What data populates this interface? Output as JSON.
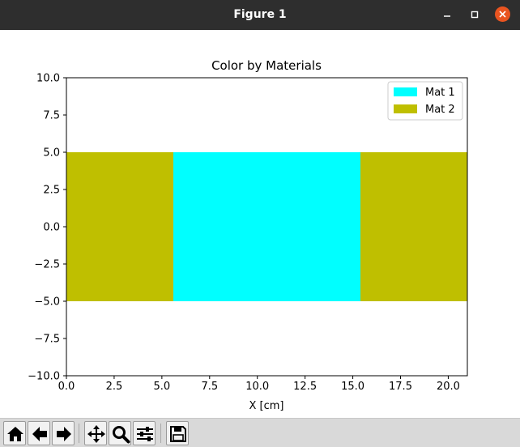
{
  "window": {
    "title": "Figure 1"
  },
  "chart_data": {
    "type": "bar",
    "title": "Color by Materials",
    "xlabel": "X [cm]",
    "ylabel": "",
    "xlim": [
      0,
      21
    ],
    "ylim": [
      -10,
      10
    ],
    "xticks": [
      "0.0",
      "2.5",
      "5.0",
      "7.5",
      "10.0",
      "12.5",
      "15.0",
      "17.5",
      "20.0"
    ],
    "yticks": [
      "10.0",
      "7.5",
      "5.0",
      "2.5",
      "0.0",
      "−2.5",
      "−5.0",
      "−7.5",
      "−10.0"
    ],
    "grid": false,
    "legend_position": "upper right",
    "series": [
      {
        "name": "Mat 1",
        "color": "#00ffff",
        "segments": [
          {
            "x0": 5.6,
            "x1": 15.4,
            "y0": -5,
            "y1": 5
          }
        ]
      },
      {
        "name": "Mat 2",
        "color": "#bfbf00",
        "segments": [
          {
            "x0": 0,
            "x1": 5.6,
            "y0": -5,
            "y1": 5
          },
          {
            "x0": 15.4,
            "x1": 21,
            "y0": -5,
            "y1": 5
          }
        ]
      }
    ]
  },
  "toolbar": {
    "buttons": [
      {
        "name": "home-button",
        "icon": "home-icon"
      },
      {
        "name": "back-button",
        "icon": "arrow-left-icon"
      },
      {
        "name": "forward-button",
        "icon": "arrow-right-icon"
      },
      {
        "name": "pan-button",
        "icon": "move-icon"
      },
      {
        "name": "zoom-button",
        "icon": "magnifier-icon"
      },
      {
        "name": "configure-subplots-button",
        "icon": "sliders-icon"
      },
      {
        "name": "save-button",
        "icon": "floppy-disk-icon"
      }
    ]
  }
}
